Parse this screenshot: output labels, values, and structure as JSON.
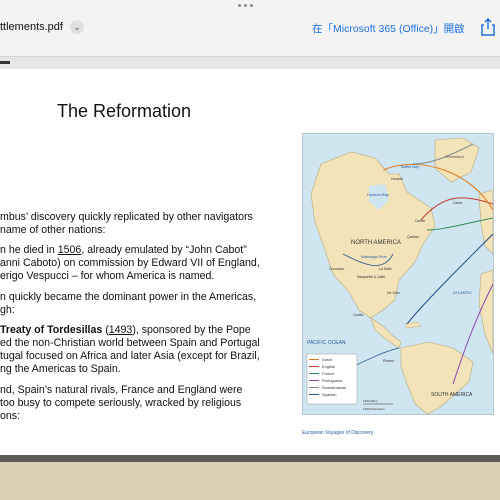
{
  "toolbar": {
    "filename": "ttlements.pdf",
    "open_in_label": "在「Microsoft 365 (Office)」開啟"
  },
  "slide": {
    "title": "The Reformation",
    "lines": [
      "mbus’ discovery quickly replicated by other navigators",
      "name of other nations:"
    ],
    "p2_pre": "n he died in ",
    "p2_year": "1506",
    "p2_post": ", already emulated by “John Cabot”",
    "p2_l2": "anni Caboto) on commission by Edward VII of England,",
    "p2_l3": "erigo Vespucci – for whom America is named.",
    "p3_l1": "n quickly became the dominant power in the Americas,",
    "p3_l2": "gh:",
    "p4_bold": "Treaty of Tordesillas",
    "p4_open": " (",
    "p4_year": "1493",
    "p4_rest": "), sponsored by the Pope",
    "p4_l2": "ed the non-Christian world between Spain and Portugal",
    "p4_l3": "tugal focused on Africa and later Asia (except for Brazil,",
    "p4_l4": "ng the Americas to Spain.",
    "p5_l1": "nd, Spain’s natural rivals, France and England were",
    "p5_l2": "too busy to compete seriously, wracked by religious",
    "p5_l3": "ons:"
  },
  "map": {
    "labels": {
      "north_america": "NORTH AMERICA",
      "south_america": "SOUTH AMERICA",
      "pacific": "PACIFIC OCEAN",
      "greenland": "Greenland",
      "baffin": "Baffin Bay",
      "hudson": "Hudson Bay",
      "atlantic": "ATLANTIC",
      "mississippi": "Mississippi River",
      "quebec": "Quebec",
      "la_salle": "La Salle",
      "coronado": "Coronado",
      "marquette": "Marquette & Joliet",
      "de_soto": "De Soto",
      "cortes": "Cortés",
      "cartier": "Cartier",
      "hudson_exp": "Hudson",
      "cabot": "Cabot",
      "magellan": "Magellan",
      "pizarro": "Pizarro",
      "scale_mi": "1500 Miles",
      "scale_km": "1500 Kilometers"
    },
    "legend": [
      {
        "label": "Dutch",
        "color": "#e07a1f"
      },
      {
        "label": "English",
        "color": "#c0392b"
      },
      {
        "label": "French",
        "color": "#2e8b57"
      },
      {
        "label": "Portuguese",
        "color": "#8e44ad"
      },
      {
        "label": "Scandinavian",
        "color": "#7f8c8d"
      },
      {
        "label": "Spanish",
        "color": "#1f4e8c"
      }
    ],
    "caption": "European Voyages of Discovery"
  }
}
